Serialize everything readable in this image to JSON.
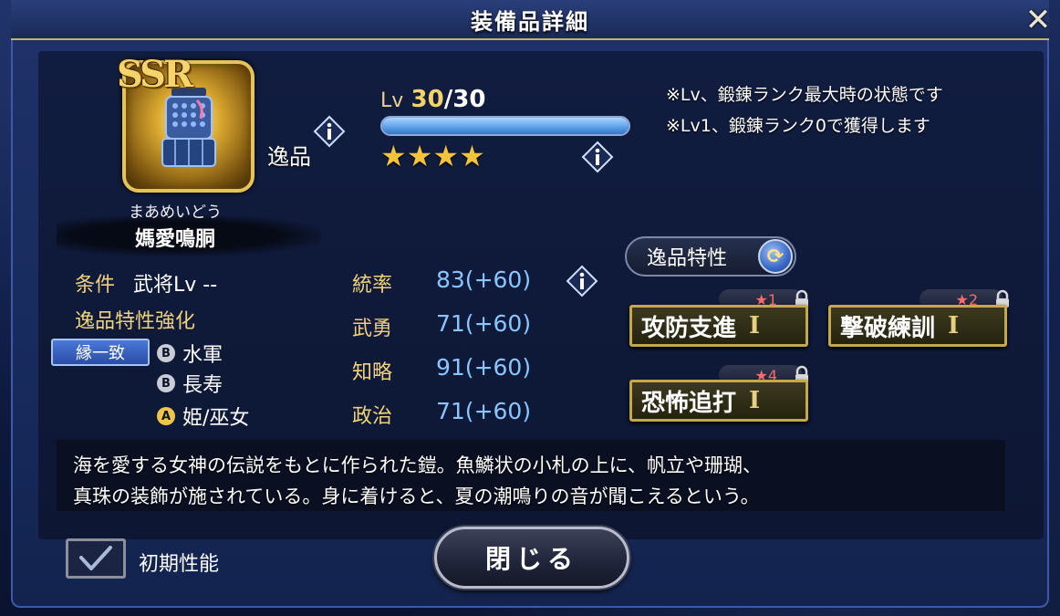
{
  "dialog": {
    "title": "装備品詳細"
  },
  "item": {
    "rarity": "SSR",
    "kind": "逸品",
    "furigana": "まあめいどう",
    "name": "媽愛鳴胴",
    "level_word": "Lv",
    "level_current": "30",
    "level_max": "/30",
    "level_fraction": 1.0,
    "stars": "★★★★",
    "star_count": 4
  },
  "notes": [
    "※Lv、鍛錬ランク最大時の状態です",
    "※Lv1、鍛錬ランク0で獲得します"
  ],
  "conditions": {
    "label": "条件",
    "value": "武将Lv --",
    "enhance_label": "逸品特性強化",
    "match_badge": "縁一致",
    "traits": [
      {
        "grade": "B",
        "name": "水軍"
      },
      {
        "grade": "B",
        "name": "長寿"
      },
      {
        "grade": "A",
        "name": "姫/巫女"
      }
    ]
  },
  "stats": [
    {
      "name": "統率",
      "value": "83(+60)"
    },
    {
      "name": "武勇",
      "value": "71(+60)"
    },
    {
      "name": "知略",
      "value": "91(+60)"
    },
    {
      "name": "政治",
      "value": "71(+60)"
    }
  ],
  "traits_panel": {
    "header": "逸品特性",
    "skills": [
      {
        "name": "攻防支進",
        "rank": "I",
        "tag": "★1"
      },
      {
        "name": "撃破練訓",
        "rank": "I",
        "tag": "★2"
      },
      {
        "name": "恐怖追打",
        "rank": "I",
        "tag": "★4"
      }
    ]
  },
  "description": [
    "海を愛する女神の伝説をもとに作られた鎧。魚鱗状の小札の上に、帆立や珊瑚、",
    "真珠の装飾が施されている。身に着けると、夏の潮鳴りの音が聞こえるという。"
  ],
  "footer": {
    "checkbox_label": "初期性能",
    "checkbox_checked": true,
    "close_label": "閉じる"
  },
  "colors": {
    "accent_gold": "#f0d27a",
    "stat_blue": "#89c6ff",
    "star_red": "#ff6b6b"
  }
}
